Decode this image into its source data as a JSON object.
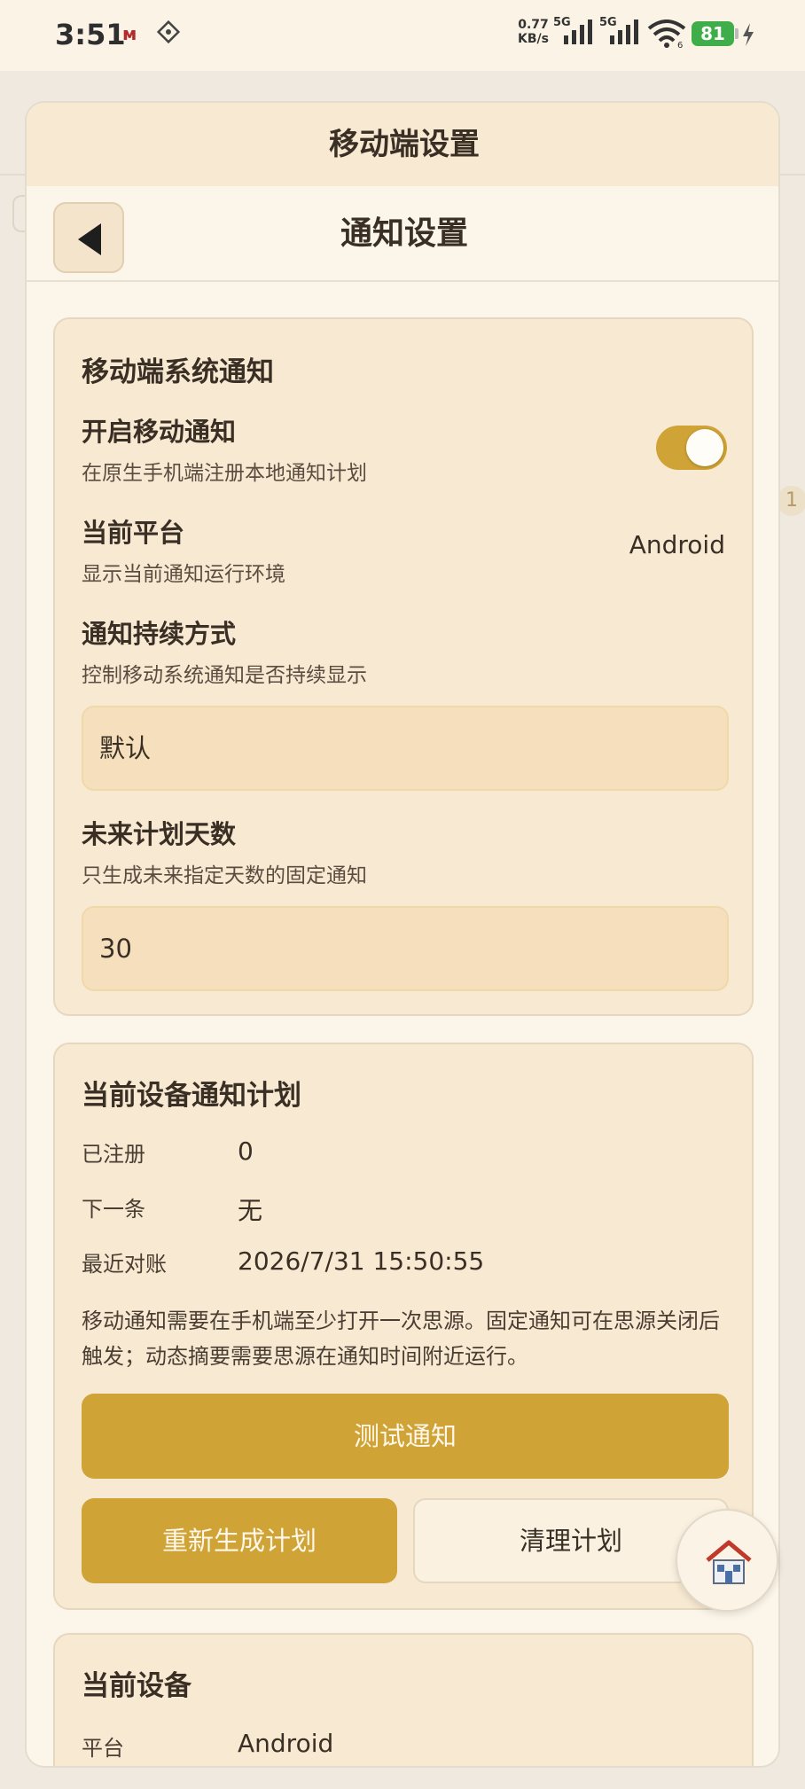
{
  "status_bar": {
    "time": "3:51",
    "net_speed_value": "0.77",
    "net_speed_unit": "KB/s",
    "sim1": "5G",
    "sim2": "5G",
    "wifi_badge": "6",
    "battery": "81"
  },
  "background": {
    "badge": "1"
  },
  "dialog": {
    "title": "移动端设置",
    "nav_title": "通知设置"
  },
  "system_notify": {
    "title": "移动端系统通知",
    "enable_label": "开启移动通知",
    "enable_desc": "在原生手机端注册本地通知计划",
    "enable_on": true,
    "platform_label": "当前平台",
    "platform_desc": "显示当前通知运行环境",
    "platform_value": "Android",
    "persist_label": "通知持续方式",
    "persist_desc": "控制移动系统通知是否持续显示",
    "persist_value": "默认",
    "days_label": "未来计划天数",
    "days_desc": "只生成未来指定天数的固定通知",
    "days_value": "30"
  },
  "device_plan": {
    "title": "当前设备通知计划",
    "rows": [
      {
        "key": "已注册",
        "value": "0"
      },
      {
        "key": "下一条",
        "value": "无"
      },
      {
        "key": "最近对账",
        "value": "2026/7/31 15:50:55"
      }
    ],
    "note": "移动通知需要在手机端至少打开一次思源。固定通知可在思源关闭后触发；动态摘要需要思源在通知时间附近运行。",
    "test_button": "测试通知",
    "regen_button": "重新生成计划",
    "clear_button": "清理计划"
  },
  "current_device": {
    "title": "当前设备",
    "platform_key": "平台",
    "platform_value": "Android"
  },
  "colors": {
    "accent": "#cfa336",
    "card_bg": "#f8e9d2",
    "battery": "#3fae4a"
  },
  "icons": [
    "back-arrow-icon",
    "home-icon",
    "signal-icon",
    "wifi-icon",
    "charging-icon"
  ]
}
